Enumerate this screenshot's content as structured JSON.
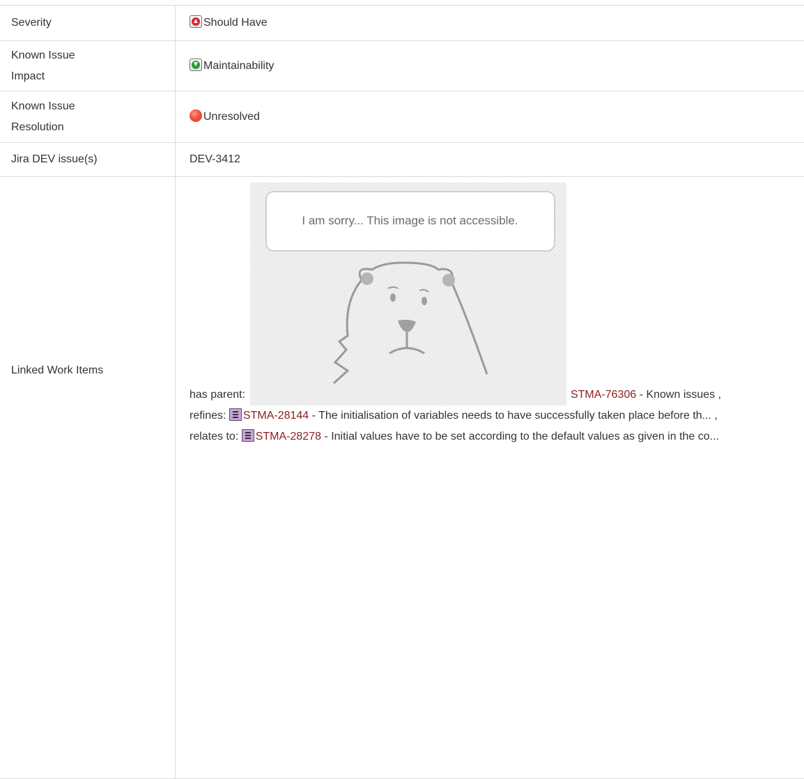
{
  "rows": [
    {
      "label": "Severity",
      "value": "Should Have",
      "icon": "arrow-up-red-icon"
    },
    {
      "label": "Known Issue Impact",
      "value": "Maintainability",
      "icon": "arrow-down-green-icon"
    },
    {
      "label": "Known Issue Resolution",
      "value": "Unresolved",
      "icon": "red-dot-icon"
    },
    {
      "label": "Jira DEV issue(s)",
      "value": "DEV-3412"
    },
    {
      "label": "Linked Work Items"
    }
  ],
  "image_placeholder": {
    "message": "I am sorry... This image is not accessible."
  },
  "links": [
    {
      "relation": "has parent:",
      "id": "STMA-76306",
      "title": "- Known issues ,"
    },
    {
      "relation": "refines:",
      "id": "STMA-28144",
      "title": "- The initialisation of variables needs to have successfully taken place before th... ,"
    },
    {
      "relation": "relates to:",
      "id": "STMA-28278",
      "title": "- Initial values have to be set according to the default values as given in the co..."
    }
  ],
  "colors": {
    "link": "#8a1f1f",
    "border": "#dcdcdc",
    "text": "#333333"
  }
}
